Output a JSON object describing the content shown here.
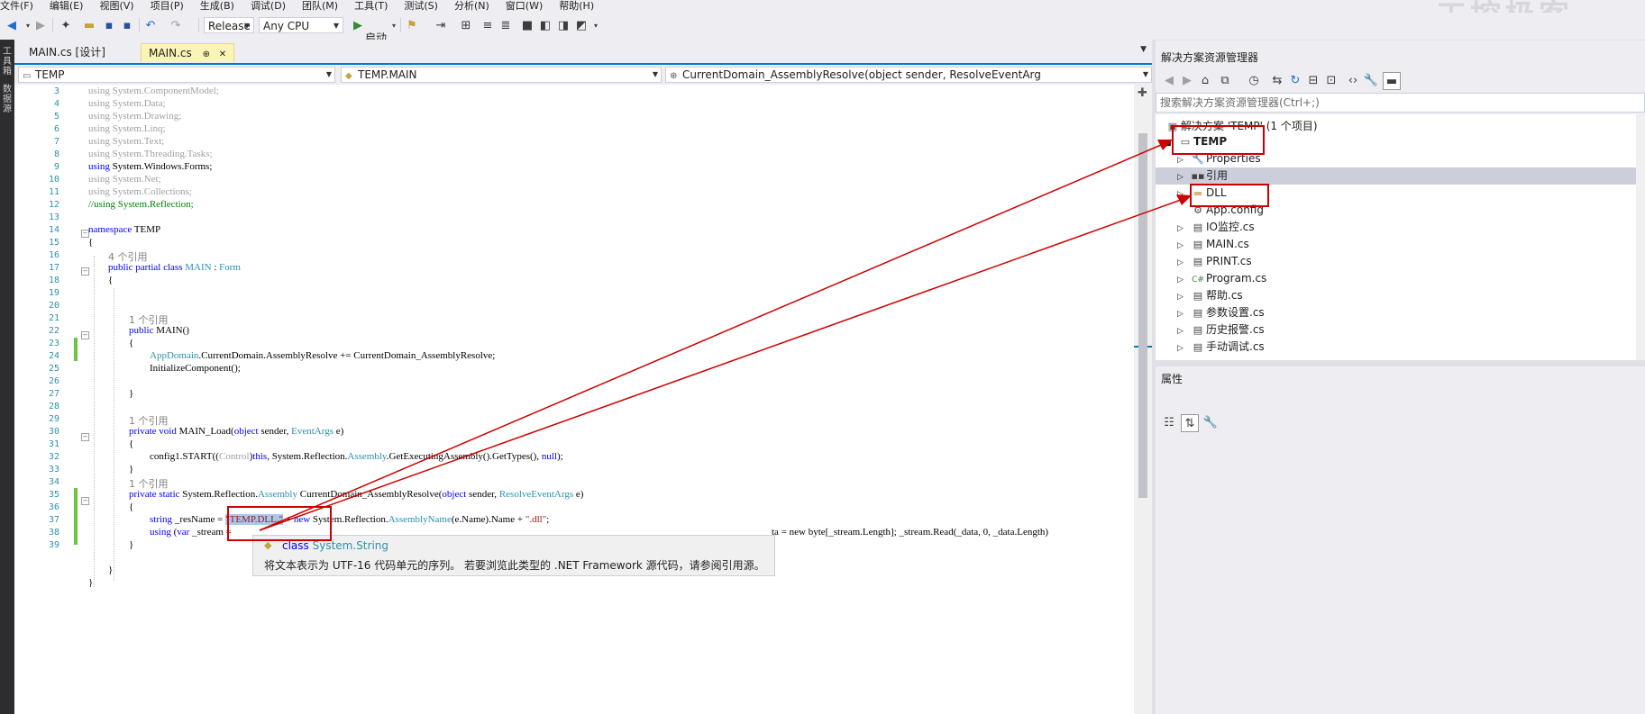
{
  "menu": [
    "文件(F)",
    "编辑(E)",
    "视图(V)",
    "项目(P)",
    "生成(B)",
    "调试(D)",
    "团队(M)",
    "工具(T)",
    "测试(S)",
    "分析(N)",
    "窗口(W)",
    "帮助(H)"
  ],
  "watermark": "工控极客",
  "toolbar": {
    "config": "Release",
    "platform": "Any CPU",
    "start_label": "启动"
  },
  "left_strip": {
    "toolbox": "工具箱",
    "datasource": "数据源"
  },
  "tabs": [
    {
      "label": "MAIN.cs [设计]",
      "active": false
    },
    {
      "label": "MAIN.cs",
      "active": true,
      "pin": "⊕",
      "close": "✕"
    }
  ],
  "navbar": {
    "project": "TEMP",
    "type": "TEMP.MAIN",
    "member": "CurrentDomain_AssemblyResolve(object sender, ResolveEventArg"
  },
  "code": {
    "line_numbers": [
      "3",
      "4",
      "5",
      "6",
      "7",
      "8",
      "9",
      "10",
      "11",
      "12",
      "13",
      "14",
      "15",
      "16",
      "17",
      "18",
      "19",
      "20",
      "21",
      "22",
      "23",
      "24",
      "25",
      "26",
      "27",
      "28",
      "29",
      "30",
      "31",
      "32",
      "33",
      "34",
      "35",
      "36",
      "37",
      "38",
      "39"
    ],
    "l3": "using System.ComponentModel;",
    "l4": "using System.Data;",
    "l5": "using System.Drawing;",
    "l6": "using System.Linq;",
    "l7": "using System.Text;",
    "l8": "using System.Threading.Tasks;",
    "l9_kw": "using",
    "l9_rest": " System.Windows.Forms;",
    "l10": "using System.Net;",
    "l11": "using System.Collections;",
    "l12": "//using System.Reflection;",
    "l14_kw": "namespace",
    "l14_rest": " TEMP",
    "l15": "{",
    "ref_main": "4 个引用",
    "l16_kw": "public partial class",
    "l16_name": " MAIN",
    "l16_sep": " : ",
    "l16_base": "Form",
    "l17": "{",
    "ref_ctor": "1 个引用",
    "l20_kw": "public",
    "l20_rest": " MAIN()",
    "l21": "{",
    "l22_a": "AppDomain",
    "l22_b": ".CurrentDomain.AssemblyResolve += CurrentDomain_AssemblyResolve;",
    "l23": "InitializeComponent();",
    "l25": "}",
    "ref_load": "1 个引用",
    "l27_kw": "private void",
    "l27_rest": " MAIN_Load(",
    "l27_kw2": "object",
    "l27_rest2": " sender, ",
    "l27_ty": "EventArgs",
    "l27_rest3": " e)",
    "l28": "{",
    "l29_a": "config1.START((",
    "l29_b": "Control",
    "l29_c": ")",
    "l29_d": "this",
    "l29_e": ", System.Reflection.",
    "l29_f": "Assembly",
    "l29_g": ".GetExecutingAssembly().GetTypes(), ",
    "l29_h": "null",
    "l29_i": ");",
    "l30": "}",
    "ref_resolve": "1 个引用",
    "l31_kw": "private static",
    "l31_a": " System.Reflection.",
    "l31_b": "Assembly",
    "l31_c": " CurrentDomain_AssemblyResolve(",
    "l31_kw2": "object",
    "l31_d": " sender, ",
    "l31_ty": "ResolveEventArgs",
    "l31_e": " e)",
    "l32": "{",
    "l33_kw": "string",
    "l33_a": " _resName = ",
    "l33_str": "\"TEMP.DLL.\"",
    "l33_b": " + ",
    "l33_kw2": "new",
    "l33_c": " System.Reflection.",
    "l33_ty": "AssemblyName",
    "l33_d": "(e.Name).Name + ",
    "l33_str2": "\".dll\"",
    "l33_e": ";",
    "l34_kw": "using",
    "l34_a": " (",
    "l34_kw2": "var",
    "l34_b": " _stream = ",
    "l34_tail": "ta = new byte[_stream.Length]; _stream.Read(_data, 0, _data.Length)",
    "l35": "}",
    "l37": "}",
    "l38": "}"
  },
  "tooltip": {
    "kw": "class",
    "type": "System.String",
    "desc": "将文本表示为 UTF-16 代码单元的序列。 若要浏览此类型的 .NET Framework 源代码，请参阅引用源。"
  },
  "solution_explorer": {
    "title": "解决方案资源管理器",
    "search_placeholder": "搜索解决方案资源管理器(Ctrl+;)",
    "solution": "解决方案 'TEMP' (1 个项目)",
    "project": "TEMP",
    "items": [
      {
        "label": "Properties",
        "icon": "wrench-icon"
      },
      {
        "label": "引用",
        "icon": "references-icon"
      },
      {
        "label": "DLL",
        "icon": "folder-icon"
      },
      {
        "label": "App.config",
        "icon": "config-file-icon"
      },
      {
        "label": "IO监控.cs",
        "icon": "form-file-icon"
      },
      {
        "label": "MAIN.cs",
        "icon": "form-file-icon"
      },
      {
        "label": "PRINT.cs",
        "icon": "form-file-icon"
      },
      {
        "label": "Program.cs",
        "icon": "csharp-file-icon"
      },
      {
        "label": "帮助.cs",
        "icon": "form-file-icon"
      },
      {
        "label": "参数设置.cs",
        "icon": "form-file-icon"
      },
      {
        "label": "历史报警.cs",
        "icon": "form-file-icon"
      },
      {
        "label": "手动调试.cs",
        "icon": "form-file-icon"
      }
    ]
  },
  "properties": {
    "title": "属性"
  },
  "colors": {
    "annotation_red": "#cc0000",
    "accent_blue": "#007acc",
    "change_green": "#6cc644"
  }
}
